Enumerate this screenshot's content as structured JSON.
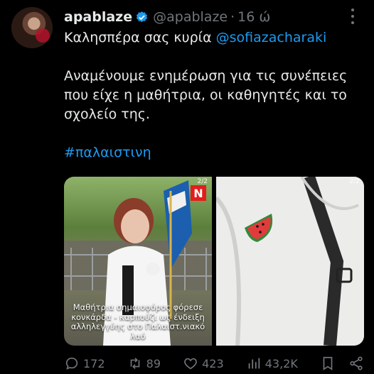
{
  "author": {
    "display_name": "apablaze",
    "handle": "@apablaze",
    "separator": "·",
    "time": "16 ώ"
  },
  "tweet": {
    "line1_prefix": "Καλησπέρα σας κυρία ",
    "mention": "@sofiazacharaki",
    "line2": "Αναμένουμε ενημέρωση για τις συνέπειες που είχε η μαθήτρια, οι καθηγητές και το σχολείο της.",
    "hashtag": "#παλαιστινη"
  },
  "media": {
    "image1": {
      "counter": "2/2",
      "caption": "Μαθήτρια σημαιοφόρος φόρεσε κονκάρδα - καρπούζι ως ένδειξη αλληλεγγύης στο Παλαιστ.νιακό λαό",
      "logo_letter": "N"
    },
    "image2": {
      "counter": "2/2"
    }
  },
  "actions": {
    "replies": "172",
    "reposts": "89",
    "likes": "423",
    "views": "43,2K"
  },
  "colors": {
    "background": "#000000",
    "text": "#e7e9ea",
    "muted": "#71767b",
    "accent": "#1d9bf0"
  },
  "icons": [
    "verified-badge-icon",
    "more-options-icon",
    "reply-icon",
    "repost-icon",
    "like-icon",
    "views-icon",
    "bookmark-icon",
    "share-icon"
  ]
}
